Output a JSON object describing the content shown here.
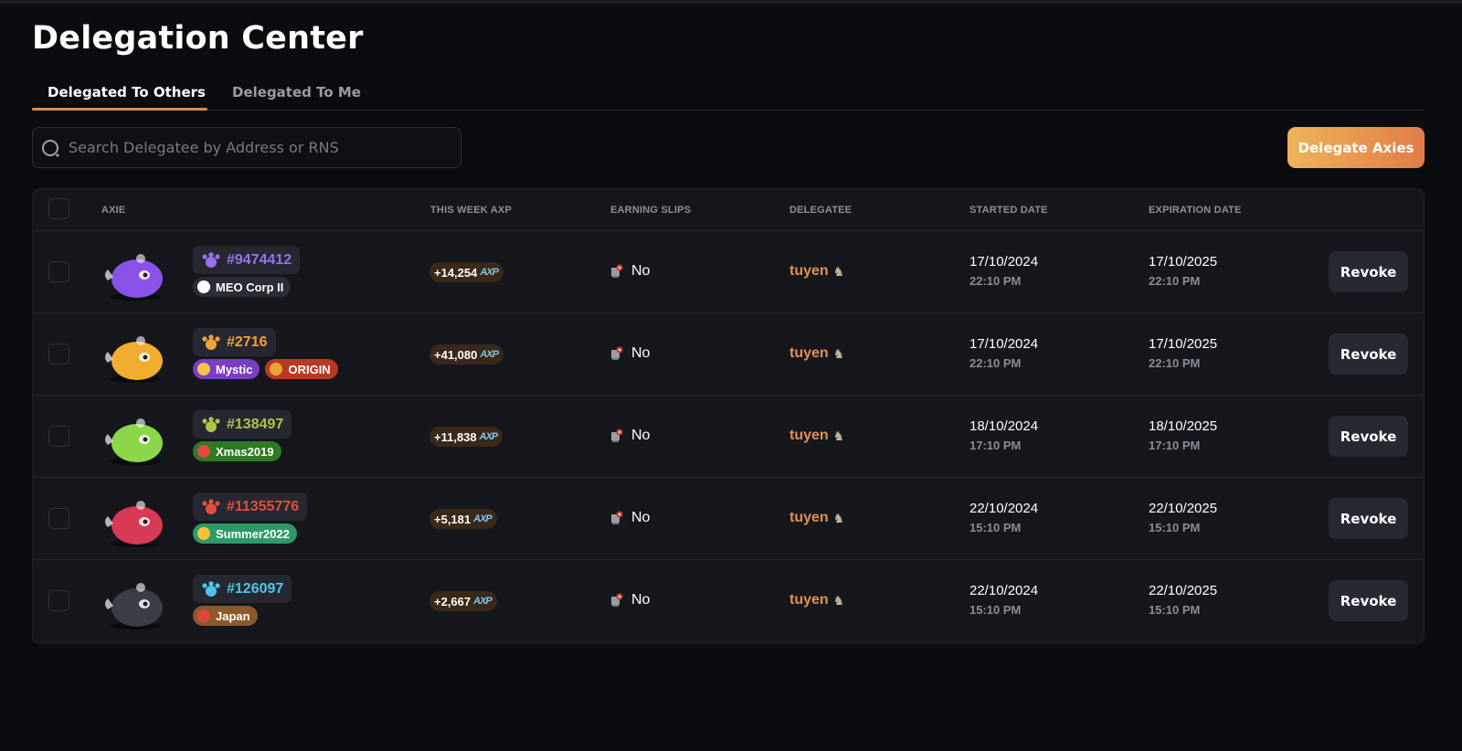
{
  "page": {
    "title": "Delegation Center"
  },
  "tabs": [
    {
      "label": "Delegated To Others",
      "active": true
    },
    {
      "label": "Delegated To Me",
      "active": false
    }
  ],
  "search": {
    "placeholder": "Search Delegatee by Address or RNS",
    "value": ""
  },
  "actions": {
    "delegate_label": "Delegate Axies"
  },
  "table": {
    "headers": {
      "axie": "AXIE",
      "axp": "THIS WEEK AXP",
      "slips": "EARNING SLIPS",
      "delegatee": "DELEGATEE",
      "started": "STARTED DATE",
      "expiration": "EXPIRATION DATE"
    },
    "rows": [
      {
        "id": "#9474412",
        "class_icon": "bug-paws-icon",
        "id_color": "#9b6ff0",
        "body_color": "#8a52e8",
        "tags": [
          {
            "label": "MEO Corp II",
            "icon": "meo-corp-icon",
            "bg": "#2a2d35",
            "icon_color": "#ffffff"
          }
        ],
        "axp": "+14,254",
        "axp_unit": "AXP",
        "slips": "No",
        "delegatee": "tuyen",
        "delegatee_icon": "goat-icon",
        "started_date": "17/10/2024",
        "started_time": "22:10 PM",
        "exp_date": "17/10/2025",
        "exp_time": "22:10 PM",
        "revoke_label": "Revoke"
      },
      {
        "id": "#2716",
        "class_icon": "paw-icon",
        "id_color": "#f0a23a",
        "body_color": "#f0ad30",
        "tags": [
          {
            "label": "Mystic",
            "icon": "sparkle-icon",
            "bg": "#7a3ec2",
            "icon_color": "#f6c445"
          },
          {
            "label": "ORIGIN",
            "icon": "origin-coin-icon",
            "bg": "#b83a22",
            "icon_color": "#e8a63a"
          }
        ],
        "axp": "+41,080",
        "axp_unit": "AXP",
        "slips": "No",
        "delegatee": "tuyen",
        "delegatee_icon": "goat-icon",
        "started_date": "17/10/2024",
        "started_time": "22:10 PM",
        "exp_date": "17/10/2025",
        "exp_time": "22:10 PM",
        "revoke_label": "Revoke"
      },
      {
        "id": "#138497",
        "class_icon": "sprout-icon",
        "id_color": "#a8c64a",
        "body_color": "#8bd64a",
        "tags": [
          {
            "label": "Xmas2019",
            "icon": "santa-hat-icon",
            "bg": "#2f7a26",
            "icon_color": "#e34a3a"
          }
        ],
        "axp": "+11,838",
        "axp_unit": "AXP",
        "slips": "No",
        "delegatee": "tuyen",
        "delegatee_icon": "goat-icon",
        "started_date": "18/10/2024",
        "started_time": "17:10 PM",
        "exp_date": "18/10/2025",
        "exp_time": "17:10 PM",
        "revoke_label": "Revoke"
      },
      {
        "id": "#11355776",
        "class_icon": "butterfly-icon",
        "id_color": "#e0503e",
        "body_color": "#d63a54",
        "tags": [
          {
            "label": "Summer2022",
            "icon": "sun-icon",
            "bg": "#2e9a6a",
            "icon_color": "#f6c23a"
          }
        ],
        "axp": "+5,181",
        "axp_unit": "AXP",
        "slips": "No",
        "delegatee": "tuyen",
        "delegatee_icon": "goat-icon",
        "started_date": "22/10/2024",
        "started_time": "15:10 PM",
        "exp_date": "22/10/2025",
        "exp_time": "15:10 PM",
        "revoke_label": "Revoke"
      },
      {
        "id": "#126097",
        "class_icon": "fish-icon",
        "id_color": "#4cc6e6",
        "body_color": "#3a3d45",
        "tags": [
          {
            "label": "Japan",
            "icon": "japan-flag-icon",
            "bg": "#8a5a2e",
            "icon_color": "#e0443a"
          }
        ],
        "axp": "+2,667",
        "axp_unit": "AXP",
        "slips": "No",
        "delegatee": "tuyen",
        "delegatee_icon": "goat-icon",
        "started_date": "22/10/2024",
        "started_time": "15:10 PM",
        "exp_date": "22/10/2025",
        "exp_time": "15:10 PM",
        "revoke_label": "Revoke"
      }
    ]
  }
}
